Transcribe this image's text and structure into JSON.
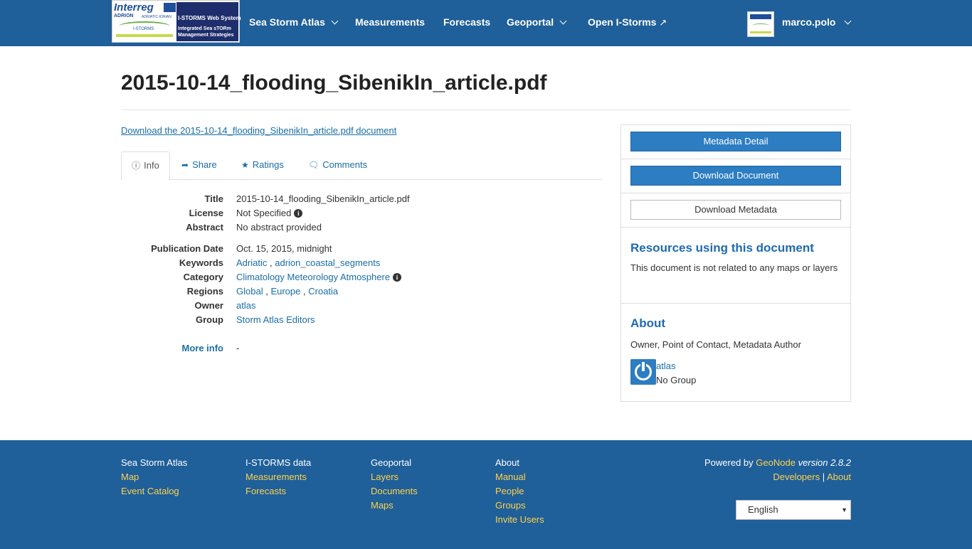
{
  "navbar": {
    "logo": {
      "interreg": "Interreg",
      "adrion": "ADRION",
      "adriatic_ionian": "ADRIATIC-IONIAN",
      "istorms_small": "I-STORMS",
      "web_system": "I-STORMS Web System",
      "integrated": "Integrated Sea sTORm",
      "management": "Management Strategies"
    },
    "items": [
      {
        "label": "Sea Storm Atlas",
        "dropdown": true
      },
      {
        "label": "Measurements",
        "dropdown": false
      },
      {
        "label": "Forecasts",
        "dropdown": false
      },
      {
        "label": "Geoportal",
        "dropdown": true
      },
      {
        "label": "Open I-Storms",
        "dropdown": false,
        "icon": "external-link-icon"
      }
    ],
    "user": {
      "name": "marco.polo"
    }
  },
  "page": {
    "title": "2015-10-14_flooding_SibenikIn_article.pdf",
    "download_link": "Download the 2015-10-14_flooding_SibenikIn_article.pdf document"
  },
  "tabs": [
    {
      "label": "Info",
      "icon": "info-circle-icon",
      "active": true
    },
    {
      "label": "Share",
      "icon": "share-icon"
    },
    {
      "label": "Ratings",
      "icon": "star-icon"
    },
    {
      "label": "Comments",
      "icon": "comment-icon"
    }
  ],
  "metadata": {
    "title_label": "Title",
    "title_value": "2015-10-14_flooding_SibenikIn_article.pdf",
    "license_label": "License",
    "license_value": "Not Specified",
    "abstract_label": "Abstract",
    "abstract_value": "No abstract provided",
    "pubdate_label": "Publication Date",
    "pubdate_value": "Oct. 15, 2015, midnight",
    "keywords_label": "Keywords",
    "keywords": [
      "Adriatic",
      "adrion_coastal_segments"
    ],
    "category_label": "Category",
    "category_value": "Climatology Meteorology Atmosphere",
    "regions_label": "Regions",
    "regions": [
      "Global",
      "Europe",
      "Croatia"
    ],
    "owner_label": "Owner",
    "owner_value": "atlas",
    "group_label": "Group",
    "group_value": "Storm Atlas Editors",
    "more_info_label": "More info",
    "more_info_value": "-",
    "separator": ","
  },
  "side": {
    "metadata_detail": "Metadata Detail",
    "download_document": "Download Document",
    "download_metadata": "Download Metadata",
    "resources_title": "Resources using this document",
    "resources_text": "This document is not related to any maps or layers",
    "about_title": "About",
    "about_roles": "Owner, Point of Contact, Metadata Author",
    "owner_name": "atlas",
    "owner_group": "No Group"
  },
  "footer": {
    "col1": {
      "heading": "Sea Storm Atlas",
      "links": [
        "Map",
        "Event Catalog"
      ]
    },
    "col2": {
      "heading": "I-STORMS data",
      "links": [
        "Measurements",
        "Forecasts"
      ]
    },
    "col3": {
      "heading": "Geoportal",
      "links": [
        "Layers",
        "Documents",
        "Maps"
      ]
    },
    "col4": {
      "heading": "About",
      "links": [
        "Manual",
        "People",
        "Groups",
        "Invite Users"
      ]
    },
    "powered_prefix": "Powered by",
    "geonode": "GeoNode",
    "version": "version 2.8.2",
    "developers": "Developers",
    "pipe": "|",
    "about": "About",
    "language": "English"
  },
  "colors": {
    "navbar": "#1f5f9a",
    "link": "#1a6ea8",
    "footer_link": "#ffd24a",
    "button_primary": "#2c7dc2"
  }
}
